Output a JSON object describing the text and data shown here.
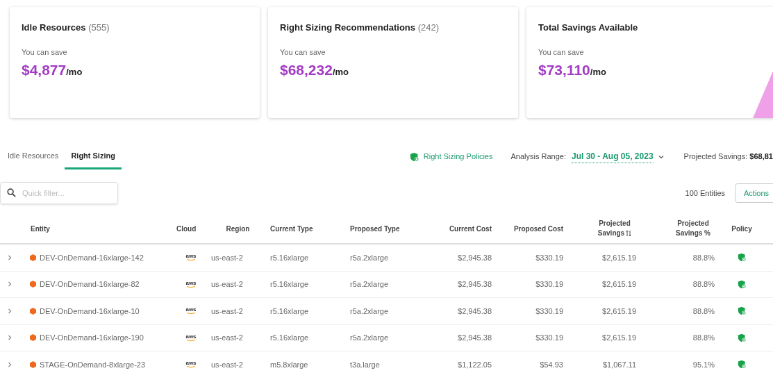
{
  "cards": [
    {
      "title": "Idle Resources",
      "count": "(555)",
      "caption": "You can save",
      "amount": "$4,877",
      "unit": "/mo"
    },
    {
      "title": "Right Sizing Recommendations",
      "count": "(242)",
      "caption": "You can save",
      "amount": "$68,232",
      "unit": "/mo"
    },
    {
      "title": "Total Savings Available",
      "caption": "You can save",
      "amount": "$73,110",
      "unit": "/mo"
    }
  ],
  "tabs": [
    {
      "label": "Idle Resources",
      "selected": false
    },
    {
      "label": "Right Sizing",
      "selected": true
    }
  ],
  "policies_link": "Right Sizing Policies",
  "analysis_range": {
    "label": "Analysis Range:",
    "value": "Jul 30 - Aug 05, 2023"
  },
  "projected_savings": {
    "label": "Projected Savings:",
    "value": "$68,81"
  },
  "search": {
    "placeholder": "Quick filter..."
  },
  "entity_count": "100 Entities",
  "actions_button": "Actions",
  "table": {
    "columns": [
      "Entity",
      "Cloud",
      "Region",
      "Current Type",
      "Proposed Type",
      "Current Cost",
      "Proposed Cost",
      "Projected Savings",
      "Projected Savings %",
      "Policy"
    ],
    "rows": [
      {
        "entity": "DEV-OnDemand-16xlarge-142",
        "cloud": "aws",
        "region": "us-east-2",
        "current_type": "r5.16xlarge",
        "proposed_type": "r5a.2xlarge",
        "current_cost": "$2,945.38",
        "proposed_cost": "$330.19",
        "savings": "$2,615.19",
        "savings_pct": "88.8%"
      },
      {
        "entity": "DEV-OnDemand-16xlarge-82",
        "cloud": "aws",
        "region": "us-east-2",
        "current_type": "r5.16xlarge",
        "proposed_type": "r5a.2xlarge",
        "current_cost": "$2,945.38",
        "proposed_cost": "$330.19",
        "savings": "$2,615.19",
        "savings_pct": "88.8%"
      },
      {
        "entity": "DEV-OnDemand-16xlarge-10",
        "cloud": "aws",
        "region": "us-east-2",
        "current_type": "r5.16xlarge",
        "proposed_type": "r5a.2xlarge",
        "current_cost": "$2,945.38",
        "proposed_cost": "$330.19",
        "savings": "$2,615.19",
        "savings_pct": "88.8%"
      },
      {
        "entity": "DEV-OnDemand-16xlarge-190",
        "cloud": "aws",
        "region": "us-east-2",
        "current_type": "r5.16xlarge",
        "proposed_type": "r5a.2xlarge",
        "current_cost": "$2,945.38",
        "proposed_cost": "$330.19",
        "savings": "$2,615.19",
        "savings_pct": "88.8%"
      },
      {
        "entity": "STAGE-OnDemand-8xlarge-23",
        "cloud": "aws",
        "region": "us-east-2",
        "current_type": "m5.8xlarge",
        "proposed_type": "t3a.large",
        "current_cost": "$1,122.05",
        "proposed_cost": "$54.93",
        "savings": "$1,067.11",
        "savings_pct": "95.1%"
      }
    ]
  }
}
